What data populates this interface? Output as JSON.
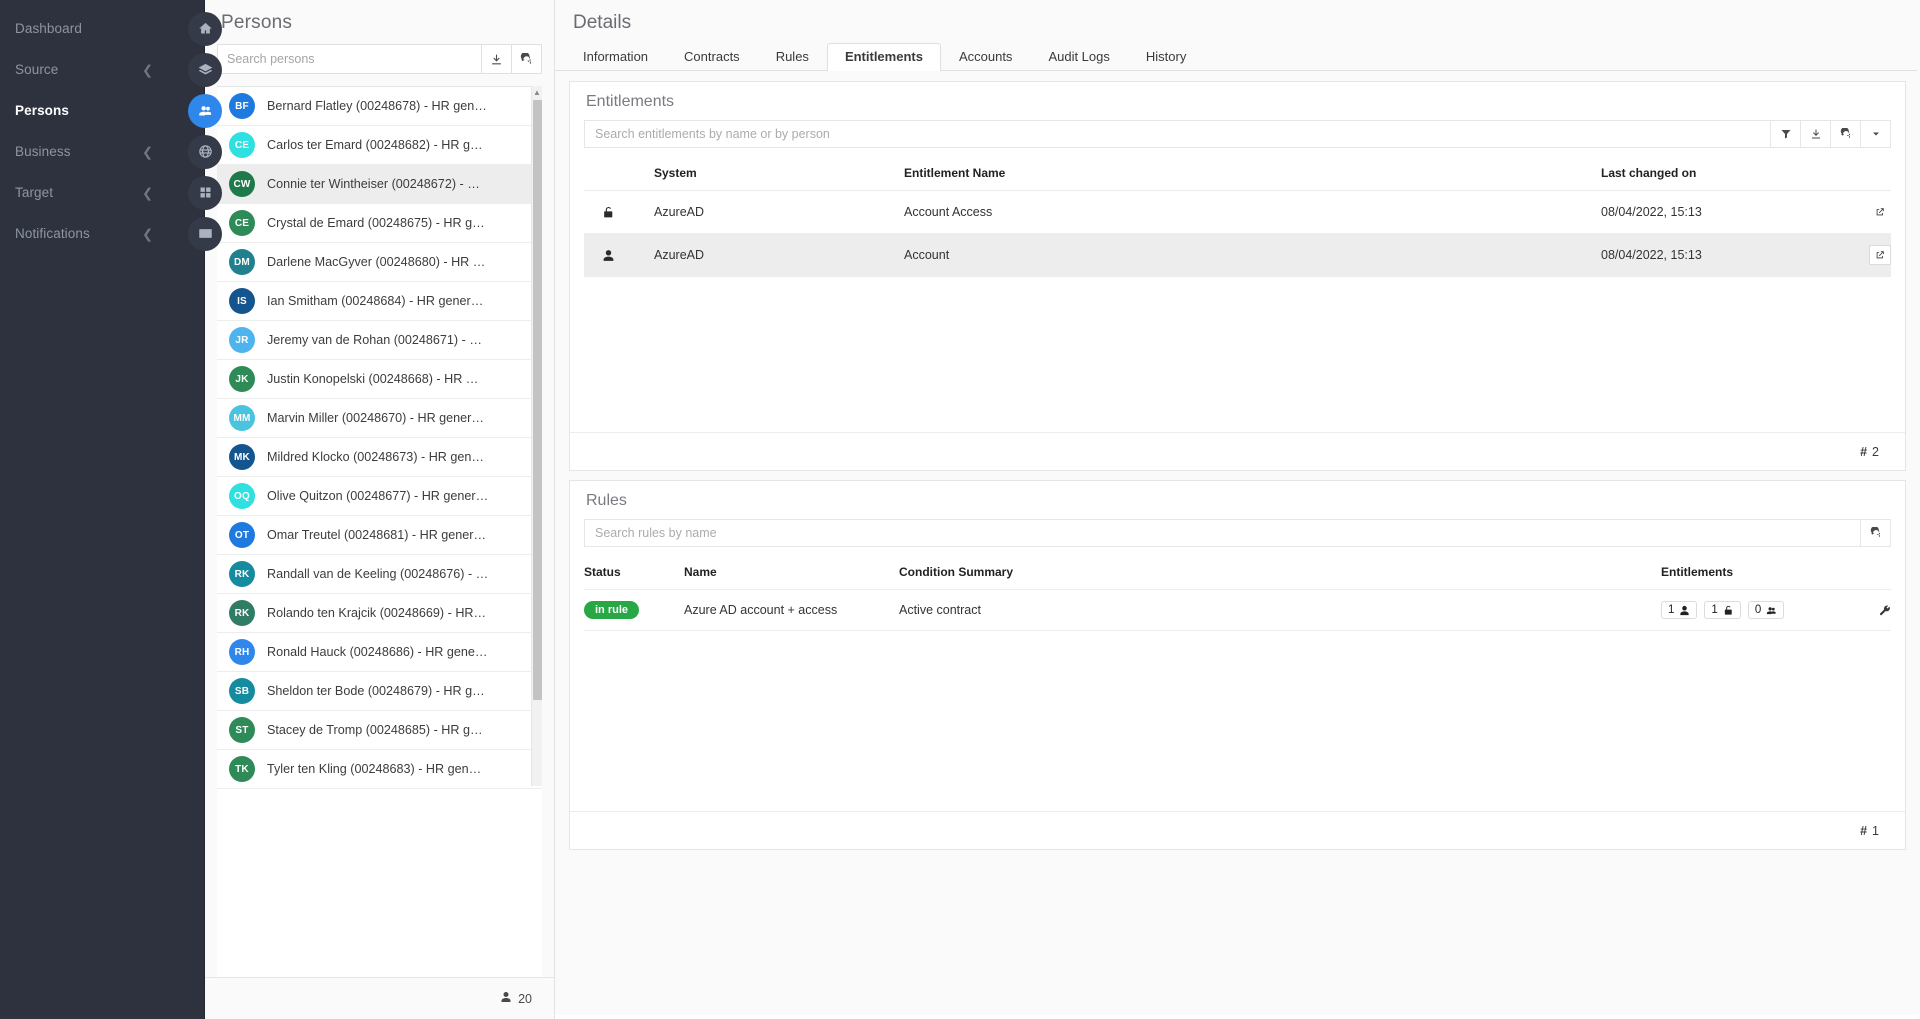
{
  "sidebar": {
    "items": [
      {
        "label": "Dashboard",
        "icon": "home-icon",
        "chevron": false,
        "active": false
      },
      {
        "label": "Source",
        "icon": "layers-icon",
        "chevron": true,
        "active": false
      },
      {
        "label": "Persons",
        "icon": "people-icon",
        "chevron": false,
        "active": true
      },
      {
        "label": "Business",
        "icon": "globe-icon",
        "chevron": true,
        "active": false
      },
      {
        "label": "Target",
        "icon": "grid-icon",
        "chevron": true,
        "active": false
      },
      {
        "label": "Notifications",
        "icon": "envelope-icon",
        "chevron": true,
        "active": false
      }
    ],
    "accent_active": "#2f87eb",
    "background": "#2d323e"
  },
  "persons_panel": {
    "title": "Persons",
    "search": {
      "value": "",
      "placeholder": "Search persons"
    },
    "toolbar": [
      {
        "name": "download-icon",
        "title": "Download"
      },
      {
        "name": "refresh-icon",
        "title": "Refresh"
      }
    ],
    "items": [
      {
        "initials": "BF",
        "color": "#1f7ae0",
        "label": "Bernard Flatley (00248678) - HR gen…",
        "selected": false
      },
      {
        "initials": "CE",
        "color": "#2ee0e0",
        "label": "Carlos ter Emard (00248682) - HR g…",
        "selected": false
      },
      {
        "initials": "CW",
        "color": "#1e7a4a",
        "label": "Connie ter Wintheiser (00248672) - …",
        "selected": true
      },
      {
        "initials": "CE",
        "color": "#2e8b57",
        "label": "Crystal de Emard (00248675) - HR g…",
        "selected": false
      },
      {
        "initials": "DM",
        "color": "#21808d",
        "label": "Darlene MacGyver (00248680) - HR …",
        "selected": false
      },
      {
        "initials": "IS",
        "color": "#14558f",
        "label": "Ian Smitham (00248684) - HR gener…",
        "selected": false
      },
      {
        "initials": "JR",
        "color": "#4db4ee",
        "label": "Jeremy van de Rohan (00248671) - …",
        "selected": false
      },
      {
        "initials": "JK",
        "color": "#2e8b57",
        "label": "Justin Konopelski (00248668) - HR …",
        "selected": false
      },
      {
        "initials": "MM",
        "color": "#4ac3de",
        "label": "Marvin Miller (00248670) - HR gener…",
        "selected": false
      },
      {
        "initials": "MK",
        "color": "#14558f",
        "label": "Mildred Klocko (00248673) - HR gen…",
        "selected": false
      },
      {
        "initials": "OQ",
        "color": "#2ee0e0",
        "label": "Olive Quitzon (00248677) - HR gener…",
        "selected": false
      },
      {
        "initials": "OT",
        "color": "#1f7ae0",
        "label": "Omar Treutel (00248681) - HR gener…",
        "selected": false
      },
      {
        "initials": "RK",
        "color": "#148b9e",
        "label": "Randall van de Keeling (00248676) - …",
        "selected": false
      },
      {
        "initials": "RK",
        "color": "#2e7d64",
        "label": "Rolando ten Krajcik (00248669) - HR…",
        "selected": false
      },
      {
        "initials": "RH",
        "color": "#2f87eb",
        "label": "Ronald Hauck (00248686) - HR gene…",
        "selected": false
      },
      {
        "initials": "SB",
        "color": "#148b9e",
        "label": "Sheldon ter Bode (00248679) - HR g…",
        "selected": false
      },
      {
        "initials": "ST",
        "color": "#2e8b57",
        "label": "Stacey de Tromp (00248685) - HR g…",
        "selected": false
      },
      {
        "initials": "TK",
        "color": "#2e8b57",
        "label": "Tyler ten Kling (00248683) - HR gen…",
        "selected": false
      }
    ],
    "footer": {
      "count": "20",
      "icon": "person-icon"
    }
  },
  "details_panel": {
    "title": "Details",
    "tabs": [
      {
        "label": "Information",
        "active": false
      },
      {
        "label": "Contracts",
        "active": false
      },
      {
        "label": "Rules",
        "active": false
      },
      {
        "label": "Entitlements",
        "active": true
      },
      {
        "label": "Accounts",
        "active": false
      },
      {
        "label": "Audit Logs",
        "active": false
      },
      {
        "label": "History",
        "active": false
      }
    ],
    "entitlements": {
      "heading": "Entitlements",
      "search": {
        "value": "",
        "placeholder": "Search entitlements by name or by person"
      },
      "toolbar": [
        {
          "name": "filter-icon"
        },
        {
          "name": "download-icon"
        },
        {
          "name": "refresh-icon"
        },
        {
          "name": "chevron-down-icon"
        }
      ],
      "columns": [
        "",
        "System",
        "Entitlement Name",
        "Last changed on",
        ""
      ],
      "rows": [
        {
          "icon": "unlock-icon",
          "system": "AzureAD",
          "entitlement_name": "Account Access",
          "last_changed_on": "08/04/2022, 15:13",
          "action": "open-external-icon",
          "selected": false
        },
        {
          "icon": "person-icon",
          "system": "AzureAD",
          "entitlement_name": "Account",
          "last_changed_on": "08/04/2022, 15:13",
          "action": "open-external-icon",
          "selected": true
        }
      ],
      "footer_count": "2"
    },
    "rules": {
      "heading": "Rules",
      "search": {
        "value": "",
        "placeholder": "Search rules by name"
      },
      "toolbar": [
        {
          "name": "refresh-icon"
        }
      ],
      "columns": [
        "Status",
        "Name",
        "Condition Summary",
        "Entitlements",
        ""
      ],
      "rows": [
        {
          "status": "in rule",
          "status_color": "#28a745",
          "name": "Azure AD account + access",
          "condition_summary": "Active contract",
          "entitlements_pills": [
            {
              "count": "1",
              "icon": "person-icon"
            },
            {
              "count": "1",
              "icon": "unlock-icon"
            },
            {
              "count": "0",
              "icon": "people-icon"
            }
          ],
          "action": "wrench-icon"
        }
      ],
      "footer_count": "1"
    }
  }
}
